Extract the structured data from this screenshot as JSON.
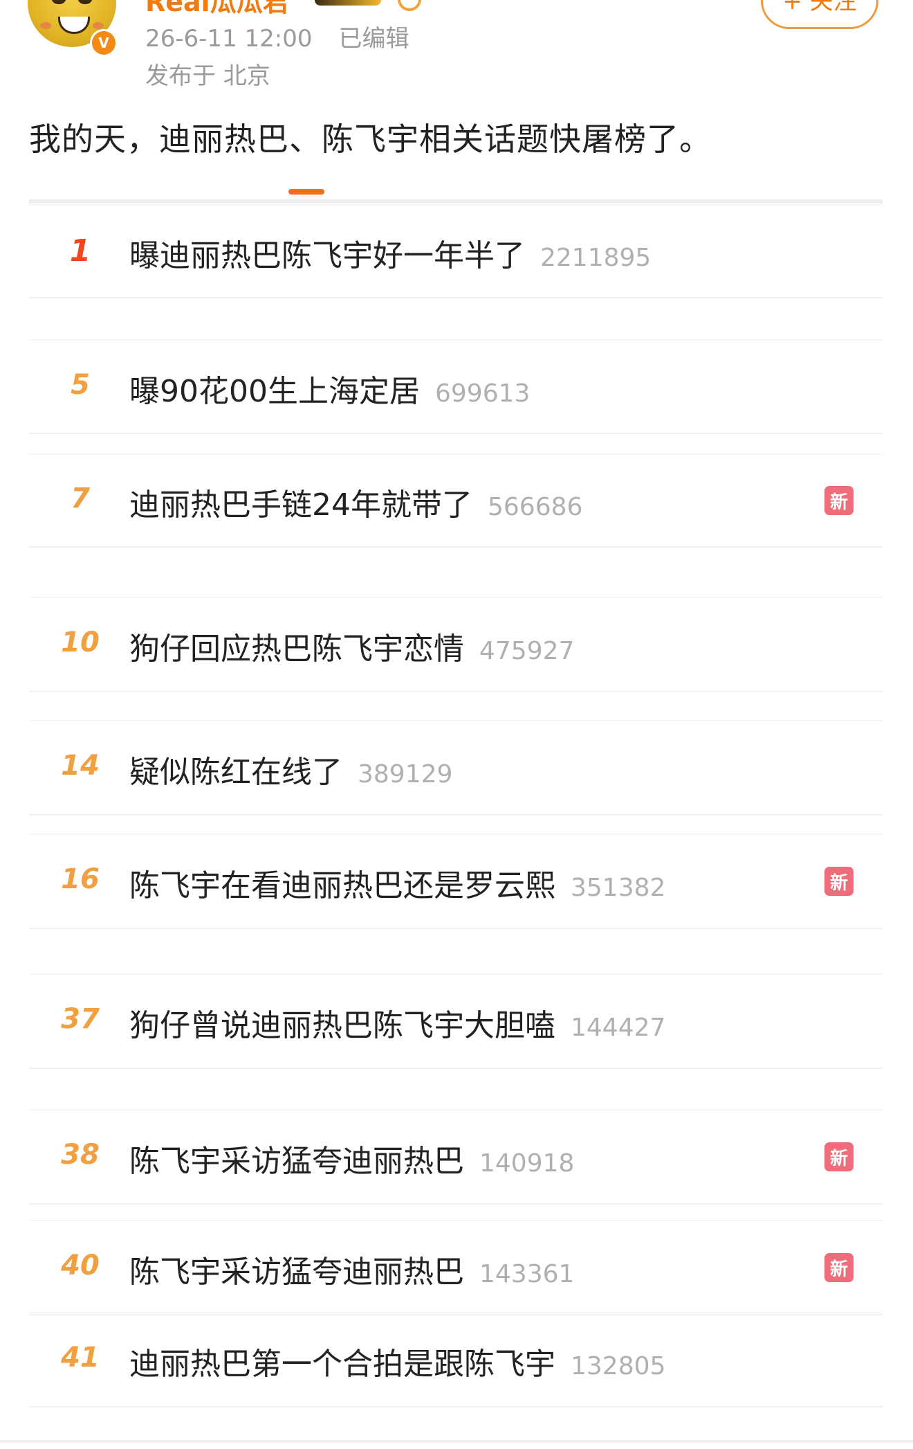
{
  "post": {
    "author_name": "Real瓜瓜君",
    "verified_badge": "V",
    "timestamp": "26-6-11 12:00",
    "edited": "已编辑",
    "location": "发布于 北京",
    "follow_label": "+ 关注",
    "text": "我的天，迪丽热巴、陈飞宇相关话题快屠榜了。"
  },
  "hot_list": {
    "new_badge_label": "新",
    "items": [
      {
        "rank": "1",
        "title": "曝迪丽热巴陈飞宇好一年半了",
        "count": "2211895",
        "is_new": false
      },
      {
        "rank": "5",
        "title": "曝90花00生上海定居",
        "count": "699613",
        "is_new": false
      },
      {
        "rank": "7",
        "title": "迪丽热巴手链24年就带了",
        "count": "566686",
        "is_new": true
      },
      {
        "rank": "10",
        "title": "狗仔回应热巴陈飞宇恋情",
        "count": "475927",
        "is_new": false
      },
      {
        "rank": "14",
        "title": "疑似陈红在线了",
        "count": "389129",
        "is_new": false
      },
      {
        "rank": "16",
        "title": "陈飞宇在看迪丽热巴还是罗云熙",
        "count": "351382",
        "is_new": true
      },
      {
        "rank": "37",
        "title": "狗仔曾说迪丽热巴陈飞宇大胆嗑",
        "count": "144427",
        "is_new": false
      },
      {
        "rank": "38",
        "title": "陈飞宇采访猛夸迪丽热巴",
        "count": "140918",
        "is_new": true
      },
      {
        "rank": "40",
        "title": "陈飞宇采访猛夸迪丽热巴",
        "count": "143361",
        "is_new": true
      },
      {
        "rank": "41",
        "title": "迪丽热巴第一个合拍是跟陈飞宇",
        "count": "132805",
        "is_new": false
      }
    ]
  },
  "colors": {
    "accent": "#f07b13",
    "rank_top": "#f2461f",
    "rank": "#f0a040",
    "new_badge": "#ef6c7a"
  }
}
